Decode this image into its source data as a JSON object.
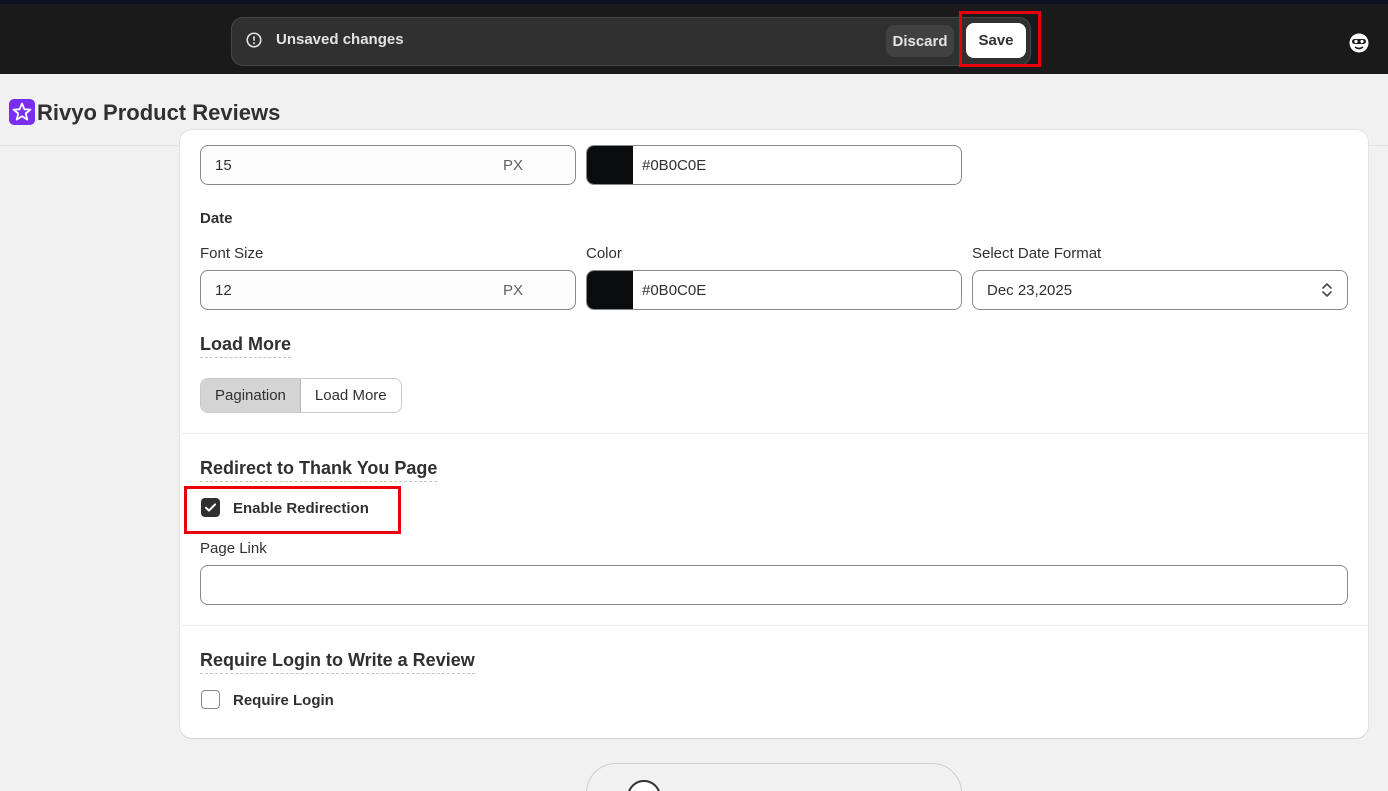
{
  "topbar": {
    "unsaved_message": "Unsaved changes",
    "discard_label": "Discard",
    "save_label": "Save",
    "alert_icon": "alert-circle-icon",
    "profile_icon": "profile-avatar-icon"
  },
  "app": {
    "title": "Rivyo Product Reviews",
    "logo_icon": "star-logo-icon",
    "logo_color": "#7a2ff0"
  },
  "previous_section": {
    "font_size_value": "15",
    "font_size_unit": "PX",
    "color_value": "#0B0C0E"
  },
  "date_section": {
    "title": "Date",
    "font_size_label": "Font Size",
    "font_size_value": "12",
    "font_size_unit": "PX",
    "color_label": "Color",
    "color_value": "#0B0C0E",
    "date_format_label": "Select Date Format",
    "date_format_value": "Dec 23,2025"
  },
  "load_more_section": {
    "heading": "Load More",
    "options": [
      "Pagination",
      "Load More"
    ],
    "selected": "Pagination"
  },
  "redirect_section": {
    "heading": "Redirect to Thank You Page",
    "checkbox_label": "Enable Redirection",
    "checked": true,
    "page_link_label": "Page Link",
    "page_link_value": ""
  },
  "login_section": {
    "heading": "Require Login to Write a Review",
    "checkbox_label": "Require Login",
    "checked": false
  },
  "colors": {
    "highlight": "#e8000b",
    "swatch": "#0B0C0E"
  }
}
